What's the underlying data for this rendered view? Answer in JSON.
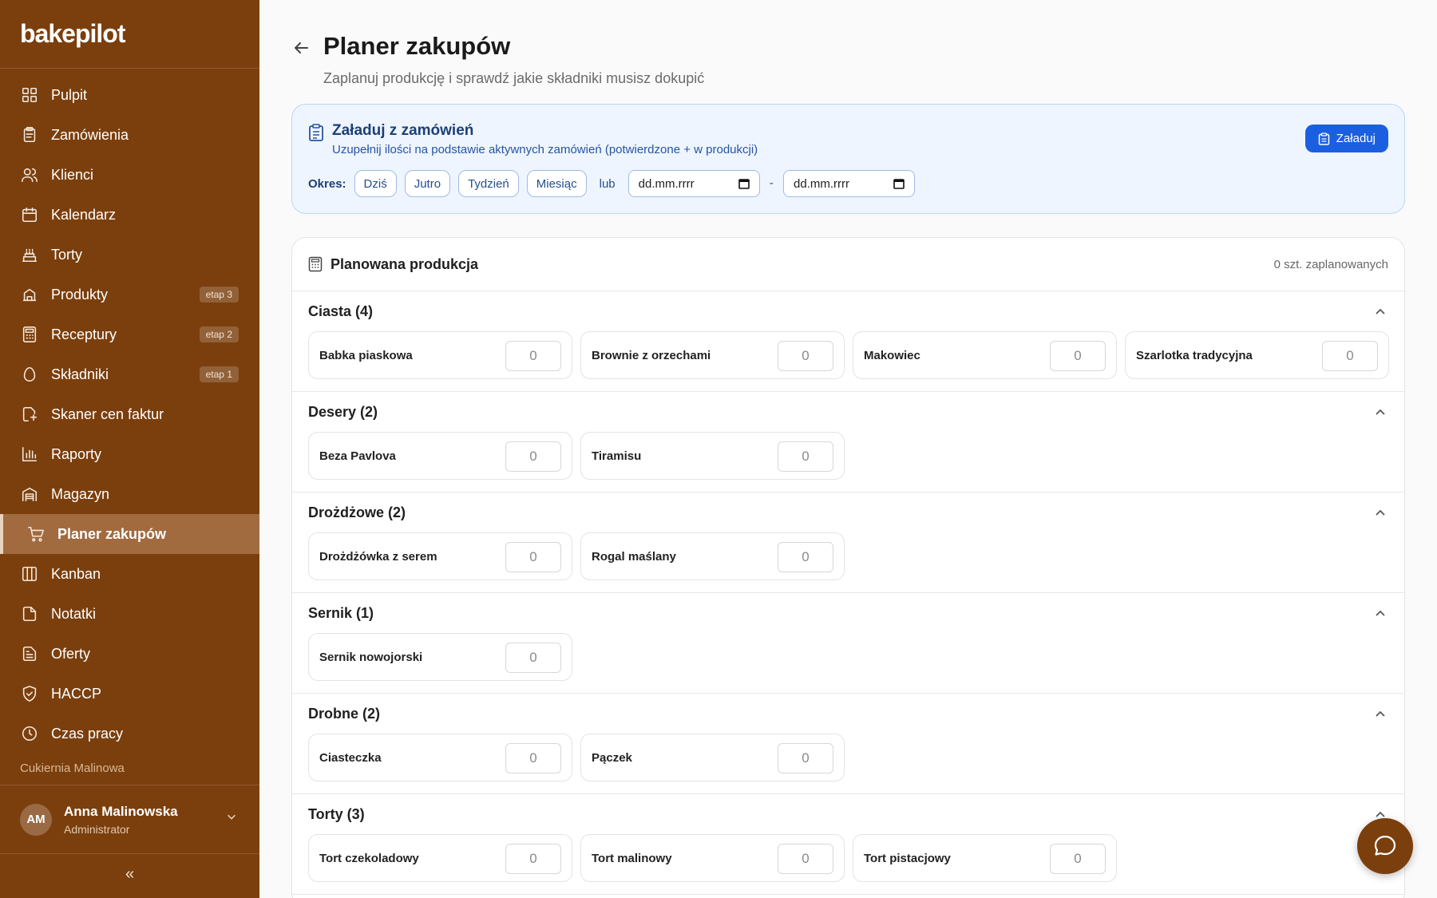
{
  "brand": "bakepilot",
  "colors": {
    "sidebar": "#7b3f0d",
    "accent": "#1a5fe0",
    "active": "#a26a3f"
  },
  "sidebar": {
    "items": [
      {
        "label": "Pulpit",
        "icon": "dashboard-icon"
      },
      {
        "label": "Zamówienia",
        "icon": "clipboard-icon"
      },
      {
        "label": "Klienci",
        "icon": "users-icon"
      },
      {
        "label": "Kalendarz",
        "icon": "calendar-icon"
      },
      {
        "label": "Torty",
        "icon": "cake-icon"
      },
      {
        "label": "Produkty",
        "icon": "bakery-icon",
        "badge": "etap 3"
      },
      {
        "label": "Receptury",
        "icon": "calculator-icon",
        "badge": "etap 2"
      },
      {
        "label": "Składniki",
        "icon": "egg-icon",
        "badge": "etap 1"
      },
      {
        "label": "Skaner cen faktur",
        "icon": "scanner-icon"
      },
      {
        "label": "Raporty",
        "icon": "chart-icon"
      },
      {
        "label": "Magazyn",
        "icon": "warehouse-icon"
      },
      {
        "label": "Planer zakupów",
        "icon": "cart-icon",
        "active": true
      },
      {
        "label": "Kanban",
        "icon": "kanban-icon"
      },
      {
        "label": "Notatki",
        "icon": "note-icon"
      },
      {
        "label": "Oferty",
        "icon": "document-icon"
      },
      {
        "label": "HACCP",
        "icon": "shield-icon"
      },
      {
        "label": "Czas pracy",
        "icon": "clock-icon"
      }
    ],
    "org": "Cukiernia Malinowa",
    "user": {
      "initials": "AM",
      "name": "Anna Malinowska",
      "role": "Administrator"
    },
    "collapse": "«"
  },
  "page": {
    "title": "Planer zakupów",
    "subtitle": "Zaplanuj produkcję i sprawdź jakie składniki musisz dokupić"
  },
  "load": {
    "title": "Załaduj z zamówień",
    "desc": "Uzupełnij ilości na podstawie aktywnych zamówień (potwierdzone + w produkcji)",
    "period_label": "Okres:",
    "chips": [
      "Dziś",
      "Jutro",
      "Tydzień",
      "Miesiąc"
    ],
    "or": "lub",
    "date_from": "dd.mm.rrrr",
    "date_to": "dd.mm.rrrr",
    "dash": "-",
    "button": "Załaduj"
  },
  "production": {
    "title": "Planowana produkcja",
    "count": "0 szt. zaplanowanych",
    "categories": [
      {
        "title": "Ciasta (4)",
        "items": [
          {
            "name": "Babka piaskowa",
            "qty": "0"
          },
          {
            "name": "Brownie z orzechami",
            "qty": "0"
          },
          {
            "name": "Makowiec",
            "qty": "0"
          },
          {
            "name": "Szarlotka tradycyjna",
            "qty": "0"
          }
        ]
      },
      {
        "title": "Desery (2)",
        "items": [
          {
            "name": "Beza Pavlova",
            "qty": "0"
          },
          {
            "name": "Tiramisu",
            "qty": "0"
          }
        ]
      },
      {
        "title": "Drożdżowe (2)",
        "items": [
          {
            "name": "Drożdżówka z serem",
            "qty": "0"
          },
          {
            "name": "Rogal maślany",
            "qty": "0"
          }
        ]
      },
      {
        "title": "Sernik (1)",
        "items": [
          {
            "name": "Sernik nowojorski",
            "qty": "0"
          }
        ]
      },
      {
        "title": "Drobne (2)",
        "items": [
          {
            "name": "Ciasteczka",
            "qty": "0"
          },
          {
            "name": "Pączek",
            "qty": "0"
          }
        ]
      },
      {
        "title": "Torty (3)",
        "items": [
          {
            "name": "Tort czekoladowy",
            "qty": "0"
          },
          {
            "name": "Tort malinowy",
            "qty": "0"
          },
          {
            "name": "Tort pistacjowy",
            "qty": "0"
          }
        ]
      }
    ]
  }
}
